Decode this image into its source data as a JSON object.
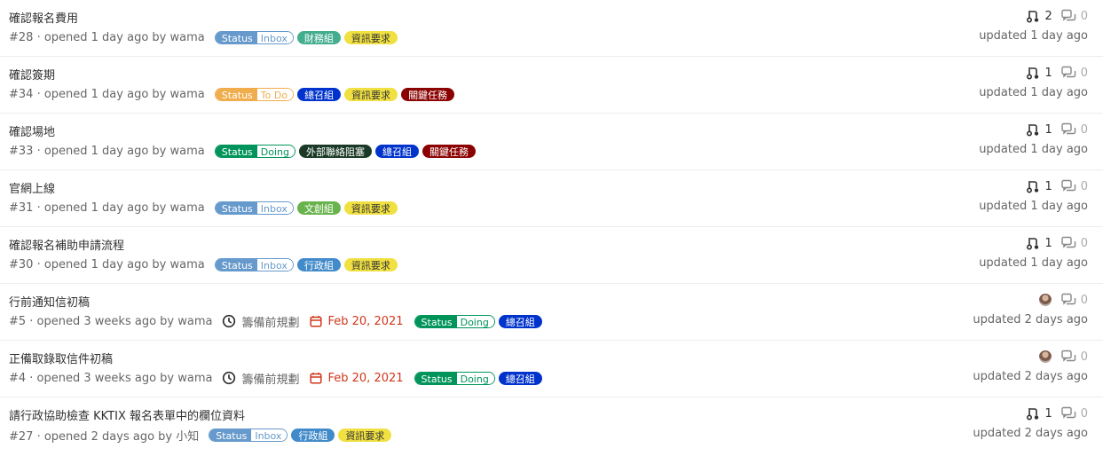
{
  "colors": {
    "status_inbox": "#6699cc",
    "status_todo": "#f0ad4e",
    "status_doing": "#00945a",
    "finance": "#44ad8e",
    "info_request": "#f0e041",
    "convener": "#0033cc",
    "key_task": "#8b0000",
    "external_blocked": "#1b3a25",
    "doc_creative": "#69b34c",
    "admin": "#428bca",
    "due_red": "#d0371b"
  },
  "issues": [
    {
      "title": "確認報名費用",
      "meta": "#28 · opened 1 day ago by wama",
      "labels": [
        {
          "type": "scoped",
          "k": "Status",
          "v": "Inbox",
          "color": "#6699cc"
        },
        {
          "type": "simple",
          "text": "財務組",
          "color": "#44ad8e",
          "fg": "#fff"
        },
        {
          "type": "simple",
          "text": "資訊要求",
          "color": "#f0e041",
          "fg": "#333"
        }
      ],
      "mr_count": "2",
      "comments": "0",
      "updated": "updated 1 day ago"
    },
    {
      "title": "確認簽期",
      "meta": "#34 · opened 1 day ago by wama",
      "labels": [
        {
          "type": "scoped",
          "k": "Status",
          "v": "To Do",
          "color": "#f0ad4e"
        },
        {
          "type": "simple",
          "text": "總召組",
          "color": "#0033cc",
          "fg": "#fff"
        },
        {
          "type": "simple",
          "text": "資訊要求",
          "color": "#f0e041",
          "fg": "#333"
        },
        {
          "type": "simple",
          "text": "關鍵任務",
          "color": "#8b0000",
          "fg": "#fff"
        }
      ],
      "mr_count": "1",
      "comments": "0",
      "updated": "updated 1 day ago"
    },
    {
      "title": "確認場地",
      "meta": "#33 · opened 1 day ago by wama",
      "labels": [
        {
          "type": "scoped",
          "k": "Status",
          "v": "Doing",
          "color": "#00945a"
        },
        {
          "type": "simple",
          "text": "外部聯絡阻塞",
          "color": "#1b3a25",
          "fg": "#fff"
        },
        {
          "type": "simple",
          "text": "總召組",
          "color": "#0033cc",
          "fg": "#fff"
        },
        {
          "type": "simple",
          "text": "關鍵任務",
          "color": "#8b0000",
          "fg": "#fff"
        }
      ],
      "mr_count": "1",
      "comments": "0",
      "updated": "updated 1 day ago"
    },
    {
      "title": "官網上線",
      "meta": "#31 · opened 1 day ago by wama",
      "labels": [
        {
          "type": "scoped",
          "k": "Status",
          "v": "Inbox",
          "color": "#6699cc"
        },
        {
          "type": "simple",
          "text": "文創組",
          "color": "#69b34c",
          "fg": "#fff"
        },
        {
          "type": "simple",
          "text": "資訊要求",
          "color": "#f0e041",
          "fg": "#333"
        }
      ],
      "mr_count": "1",
      "comments": "0",
      "updated": "updated 1 day ago"
    },
    {
      "title": "確認報名補助申請流程",
      "meta": "#30 · opened 1 day ago by wama",
      "labels": [
        {
          "type": "scoped",
          "k": "Status",
          "v": "Inbox",
          "color": "#6699cc"
        },
        {
          "type": "simple",
          "text": "行政組",
          "color": "#428bca",
          "fg": "#fff"
        },
        {
          "type": "simple",
          "text": "資訊要求",
          "color": "#f0e041",
          "fg": "#333"
        }
      ],
      "mr_count": "1",
      "comments": "0",
      "updated": "updated 1 day ago"
    },
    {
      "title": "行前通知信初稿",
      "meta": "#5 · opened 3 weeks ago by wama",
      "milestone": "籌備前規劃",
      "due": "Feb 20, 2021",
      "labels": [
        {
          "type": "scoped",
          "k": "Status",
          "v": "Doing",
          "color": "#00945a"
        },
        {
          "type": "simple",
          "text": "總召組",
          "color": "#0033cc",
          "fg": "#fff"
        }
      ],
      "assignee_avatar": true,
      "comments": "0",
      "updated": "updated 2 days ago"
    },
    {
      "title": "正備取錄取信件初稿",
      "meta": "#4 · opened 3 weeks ago by wama",
      "milestone": "籌備前規劃",
      "due": "Feb 20, 2021",
      "labels": [
        {
          "type": "scoped",
          "k": "Status",
          "v": "Doing",
          "color": "#00945a"
        },
        {
          "type": "simple",
          "text": "總召組",
          "color": "#0033cc",
          "fg": "#fff"
        }
      ],
      "assignee_avatar": true,
      "comments": "0",
      "updated": "updated 2 days ago"
    },
    {
      "title": "請行政協助檢查 KKTIX 報名表單中的欄位資料",
      "meta": "#27 · opened 2 days ago by 小知",
      "labels": [
        {
          "type": "scoped",
          "k": "Status",
          "v": "Inbox",
          "color": "#6699cc"
        },
        {
          "type": "simple",
          "text": "行政組",
          "color": "#428bca",
          "fg": "#fff"
        },
        {
          "type": "simple",
          "text": "資訊要求",
          "color": "#f0e041",
          "fg": "#333"
        }
      ],
      "mr_count": "1",
      "comments": "0",
      "updated": "updated 2 days ago"
    }
  ]
}
